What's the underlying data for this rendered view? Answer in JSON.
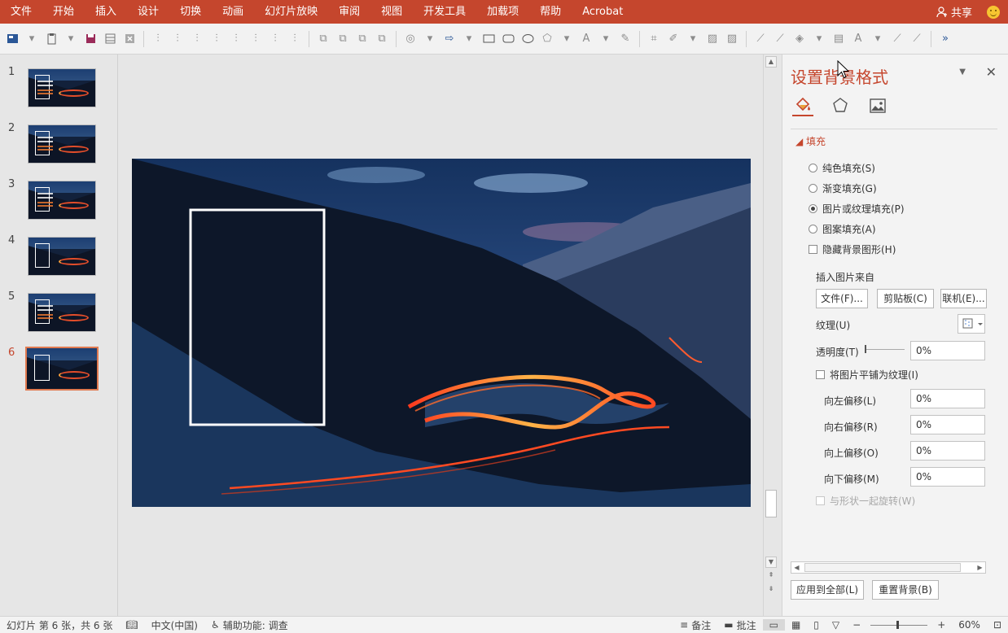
{
  "ribbon": {
    "tabs": [
      "文件",
      "开始",
      "插入",
      "设计",
      "切换",
      "动画",
      "幻灯片放映",
      "审阅",
      "视图",
      "开发工具",
      "加载项",
      "帮助",
      "Acrobat"
    ],
    "share_label": "共享"
  },
  "thumbnails": [
    {
      "number": "1"
    },
    {
      "number": "2"
    },
    {
      "number": "3"
    },
    {
      "number": "4"
    },
    {
      "number": "5"
    },
    {
      "number": "6"
    }
  ],
  "pane": {
    "title": "设置背景格式",
    "fill_section": "填充",
    "options": {
      "solid": "纯色填充(S)",
      "gradient": "渐变填充(G)",
      "picture": "图片或纹理填充(P)",
      "pattern": "图案填充(A)",
      "hide_graphics": "隐藏背景图形(H)"
    },
    "insert_from": "插入图片来自",
    "buttons": {
      "file": "文件(F)...",
      "clipboard": "剪贴板(C)",
      "online": "联机(E)..."
    },
    "texture_label": "纹理(U)",
    "transparency_label": "透明度(T)",
    "transparency_value": "0%",
    "tile_label": "将图片平铺为纹理(I)",
    "offsets": {
      "left_label": "向左偏移(L)",
      "left_value": "0%",
      "right_label": "向右偏移(R)",
      "right_value": "0%",
      "top_label": "向上偏移(O)",
      "top_value": "0%",
      "bottom_label": "向下偏移(M)",
      "bottom_value": "0%"
    },
    "rotate_label": "与形状一起旋转(W)",
    "apply_all": "应用到全部(L)",
    "reset": "重置背景(B)"
  },
  "status": {
    "slide_info": "幻灯片 第 6 张，共 6 张",
    "language": "中文(中国)",
    "accessibility": "辅助功能: 调查",
    "notes": "备注",
    "comments": "批注",
    "zoom": "60%"
  },
  "colors": {
    "accent": "#c5462d",
    "ribbon": "#c5462d",
    "selected_thumb": "#e07a50"
  }
}
